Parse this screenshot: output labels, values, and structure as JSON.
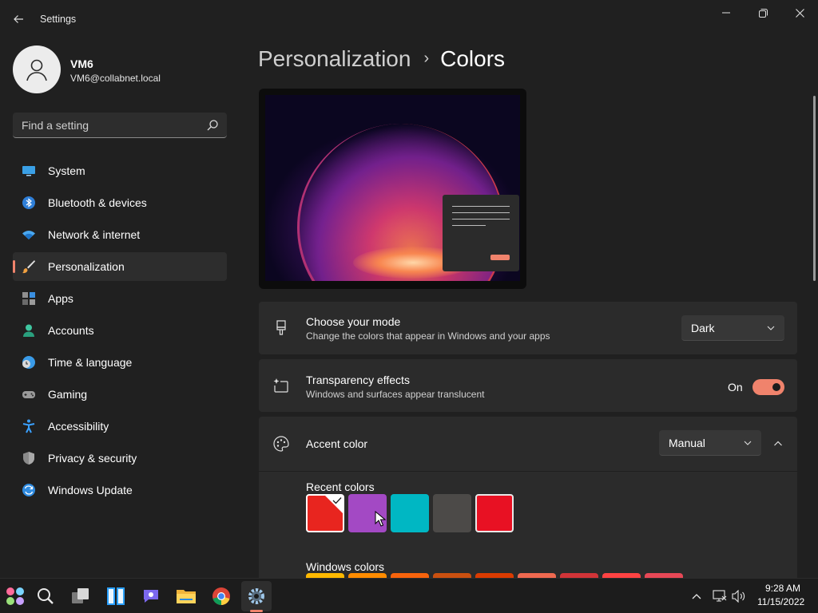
{
  "window": {
    "title": "Settings"
  },
  "user": {
    "name": "VM6",
    "email": "VM6@collabnet.local"
  },
  "search": {
    "placeholder": "Find a setting"
  },
  "nav": {
    "items": [
      {
        "label": "System",
        "icon": "monitor-icon"
      },
      {
        "label": "Bluetooth & devices",
        "icon": "bluetooth-icon"
      },
      {
        "label": "Network & internet",
        "icon": "wifi-icon"
      },
      {
        "label": "Personalization",
        "icon": "brush-icon",
        "active": true
      },
      {
        "label": "Apps",
        "icon": "apps-icon"
      },
      {
        "label": "Accounts",
        "icon": "person-icon"
      },
      {
        "label": "Time & language",
        "icon": "globe-clock-icon"
      },
      {
        "label": "Gaming",
        "icon": "gamepad-icon"
      },
      {
        "label": "Accessibility",
        "icon": "accessibility-icon"
      },
      {
        "label": "Privacy & security",
        "icon": "shield-icon"
      },
      {
        "label": "Windows Update",
        "icon": "update-icon"
      }
    ]
  },
  "breadcrumb": {
    "parent": "Personalization",
    "separator": "›",
    "current": "Colors"
  },
  "mode": {
    "title": "Choose your mode",
    "description": "Change the colors that appear in Windows and your apps",
    "value": "Dark"
  },
  "transparency": {
    "title": "Transparency effects",
    "description": "Windows and surfaces appear translucent",
    "state": "On"
  },
  "accent": {
    "title": "Accent color",
    "value": "Manual"
  },
  "recent_colors": {
    "label": "Recent colors",
    "swatches": [
      "#e8251f",
      "#a349c4",
      "#00b7c3",
      "#4c4a48",
      "#e81123"
    ]
  },
  "windows_colors": {
    "label": "Windows colors",
    "swatches": [
      "#ffb900",
      "#ff8c00",
      "#f7630c",
      "#ca5010",
      "#da3b01",
      "#ef6950",
      "#d13438",
      "#ff4343",
      "#e74856"
    ]
  },
  "accent_color": "#f0836c",
  "clock": {
    "time": "9:28 AM",
    "date": "11/15/2022"
  }
}
